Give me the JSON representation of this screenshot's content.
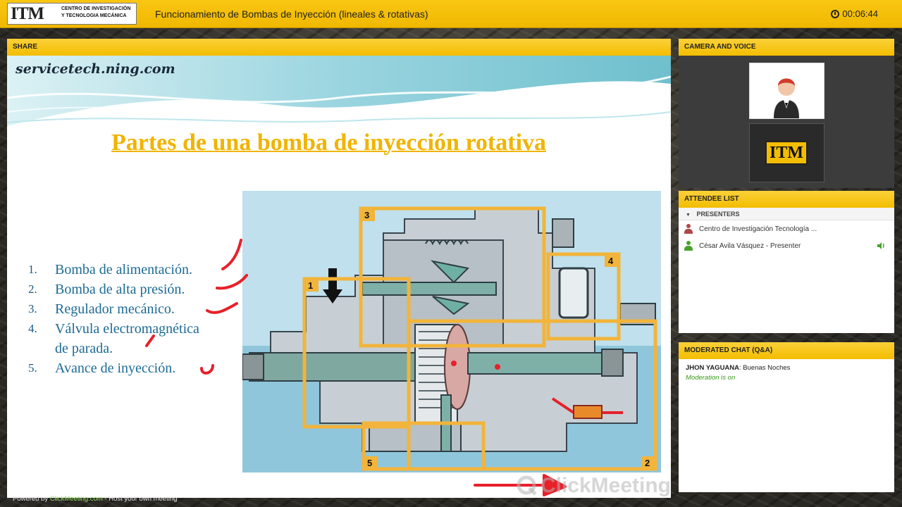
{
  "topbar": {
    "logo_mark": "ITM",
    "logo_text_line1": "CENTRO DE INVESTIGACIÓN",
    "logo_text_line2": "Y TECNOLOGIA MECÁNICA",
    "title": "Funcionamiento de Bombas de Inyección (lineales & rotativas)",
    "timer": "00:06:44"
  },
  "share": {
    "header": "SHARE",
    "slide": {
      "url": "servicetech.ning.com",
      "title": "Partes de una bomba de inyección rotativa",
      "items": [
        {
          "num": "1.",
          "text": "Bomba de alimentación."
        },
        {
          "num": "2.",
          "text": "Bomba de alta presión."
        },
        {
          "num": "3.",
          "text": "Regulador mecánico."
        },
        {
          "num": "4.",
          "text": "Válvula electromagnética"
        },
        {
          "num": "",
          "text": "de parada."
        },
        {
          "num": "5.",
          "text": "Avance de inyección."
        }
      ],
      "diagram_labels": [
        "1",
        "2",
        "3",
        "4",
        "5"
      ]
    },
    "watermark": "ClickMeeting"
  },
  "camera": {
    "header": "CAMERA AND VOICE",
    "logo_mark": "ITM"
  },
  "attendees": {
    "header": "ATTENDEE LIST",
    "group": "PRESENTERS",
    "rows": [
      {
        "name": "Centro de Investigación Tecnología ...",
        "color": "#b0484a"
      },
      {
        "name": "César Avila Vásquez - Presenter",
        "color": "#4aa02a"
      }
    ]
  },
  "chat": {
    "header": "MODERATED CHAT (Q&A)",
    "sender": "JHON YAGUANA",
    "message": ": Buenas Noches",
    "status": "Moderation is on"
  },
  "footer": {
    "prefix": "Powered by ",
    "brand": "ClickMeeting.com",
    "suffix": " - Host your own meeting"
  },
  "colors": {
    "accent": "#f3bd00",
    "title_gold": "#f0b400",
    "list_blue": "#1c6a94",
    "annotation_red": "#e8202a",
    "diagram_box": "#f2b43a"
  }
}
